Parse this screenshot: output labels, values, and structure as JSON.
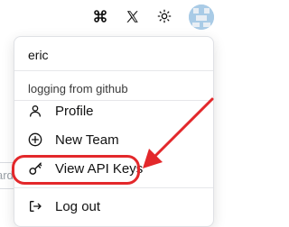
{
  "topbar": {
    "icons": [
      "command-icon",
      "x-logo-icon",
      "theme-sun-icon"
    ],
    "avatar": "user-avatar"
  },
  "background": {
    "input_fragment": "ard"
  },
  "menu": {
    "user_name": "eric",
    "user_subtitle": "logging from github",
    "items": [
      {
        "label": "Profile",
        "icon": "user-icon"
      },
      {
        "label": "New Team",
        "icon": "plus-circle-icon"
      },
      {
        "label": "View API Keys",
        "icon": "key-icon"
      },
      {
        "label": "Log out",
        "icon": "logout-icon"
      }
    ]
  },
  "annotation": {
    "highlight_color": "#e3282b",
    "highlighted_item": "View API Keys"
  }
}
